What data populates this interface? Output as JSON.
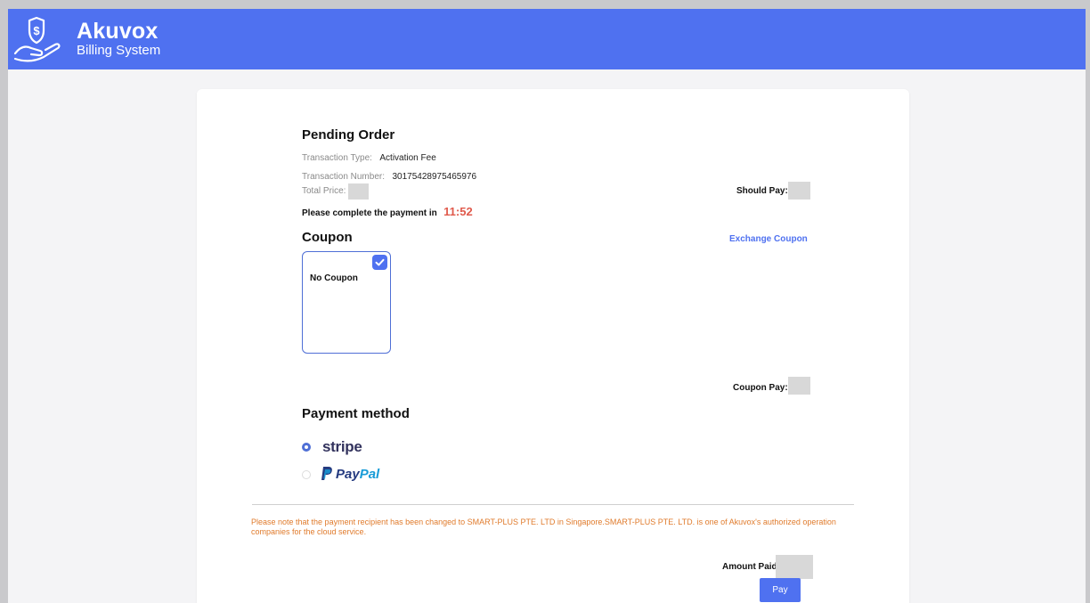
{
  "header": {
    "brand_name": "Akuvox",
    "brand_subtitle": "Billing System",
    "logo_icon": "hand-dollar-icon",
    "bg_color": "#4f71f0"
  },
  "order": {
    "title": "Pending Order",
    "transaction_type_label": "Transaction Type:",
    "transaction_type_value": "Activation Fee",
    "transaction_number_label": "Transaction Number:",
    "transaction_number_value": "30175428975465976",
    "total_price_label": "Total Price:",
    "should_pay_label": "Should Pay:",
    "countdown_text": "Please complete the payment in",
    "countdown_time": "11:52",
    "countdown_color": "#e05a4c"
  },
  "coupon": {
    "title": "Coupon",
    "exchange_link": "Exchange Coupon",
    "option_label": "No Coupon",
    "selected": true,
    "coupon_pay_label": "Coupon Pay:"
  },
  "payment": {
    "title": "Payment method",
    "options": [
      {
        "name": "stripe",
        "label": "stripe",
        "selected": true
      },
      {
        "name": "paypal",
        "label": "PayPal",
        "selected": false
      }
    ],
    "paypal_label_part1": "Pay",
    "paypal_label_part2": "Pal",
    "paypal_colors": [
      "#253b80",
      "#179bd7"
    ]
  },
  "footer": {
    "notice": "Please note that the payment recipient has been changed to SMART-PLUS PTE. LTD in Singapore.SMART-PLUS PTE. LTD. is one of Akuvox's authorized operation companies for the cloud service.",
    "notice_color": "#e07b2c",
    "amount_paid_label": "Amount Paid",
    "pay_button": "Pay"
  }
}
